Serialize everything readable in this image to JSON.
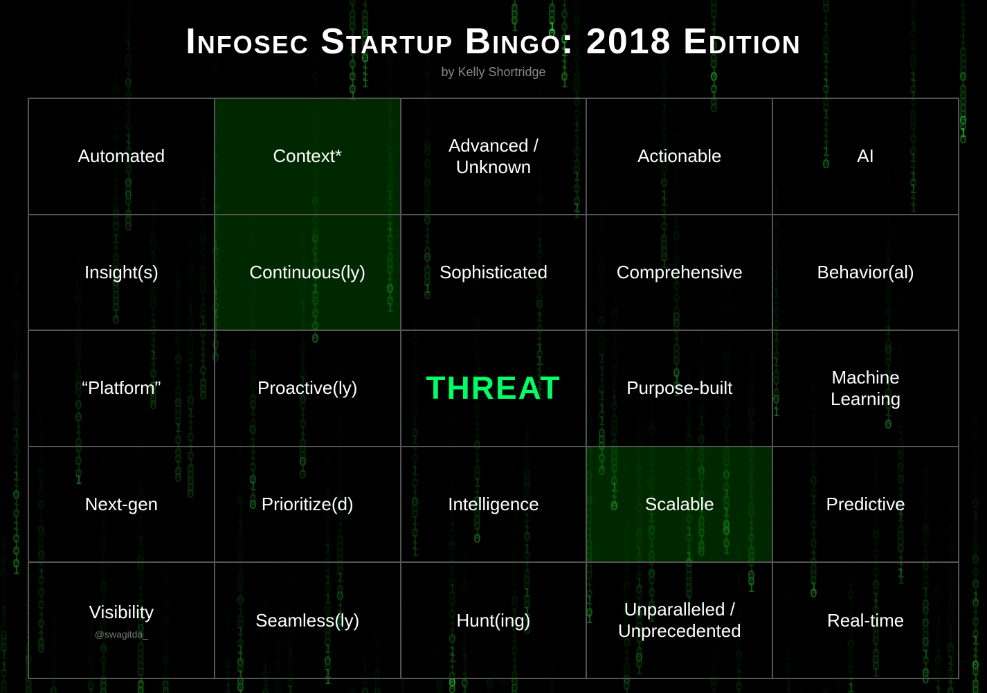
{
  "title": "Infosec Startup Bingo: 2018 Edition",
  "subtitle": "by Kelly Shortridge",
  "attribution": "@swagitda_",
  "colors": {
    "accent_green": "#00ff66",
    "text_white": "#ffffff",
    "text_gray": "#888888",
    "border": "#555555",
    "bg_cell": "rgba(0,0,0,0.45)"
  },
  "grid": [
    [
      {
        "label": "Automated",
        "highlight": false,
        "center": false
      },
      {
        "label": "Context*",
        "highlight": true,
        "center": false
      },
      {
        "label": "Advanced /\nUnknown",
        "highlight": false,
        "center": false
      },
      {
        "label": "Actionable",
        "highlight": false,
        "center": false
      },
      {
        "label": "AI",
        "highlight": false,
        "center": false
      }
    ],
    [
      {
        "label": "Insight(s)",
        "highlight": false,
        "center": false
      },
      {
        "label": "Continuous(ly)",
        "highlight": true,
        "center": false
      },
      {
        "label": "Sophisticated",
        "highlight": false,
        "center": false
      },
      {
        "label": "Comprehensive",
        "highlight": false,
        "center": false
      },
      {
        "label": "Behavior(al)",
        "highlight": false,
        "center": false
      }
    ],
    [
      {
        "label": "“Platform”",
        "highlight": false,
        "center": false
      },
      {
        "label": "Proactive(ly)",
        "highlight": false,
        "center": false
      },
      {
        "label": "THREAT",
        "highlight": false,
        "center": true
      },
      {
        "label": "Purpose-built",
        "highlight": false,
        "center": false
      },
      {
        "label": "Machine\nLearning",
        "highlight": false,
        "center": false
      }
    ],
    [
      {
        "label": "Next-gen",
        "highlight": false,
        "center": false
      },
      {
        "label": "Prioritize(d)",
        "highlight": false,
        "center": false
      },
      {
        "label": "Intelligence",
        "highlight": false,
        "center": false
      },
      {
        "label": "Scalable",
        "highlight": true,
        "center": false
      },
      {
        "label": "Predictive",
        "highlight": false,
        "center": false
      }
    ],
    [
      {
        "label": "Visibility",
        "highlight": false,
        "center": false
      },
      {
        "label": "Seamless(ly)",
        "highlight": false,
        "center": false
      },
      {
        "label": "Hunt(ing)",
        "highlight": false,
        "center": false
      },
      {
        "label": "Unparalleled /\nUnprecedented",
        "highlight": false,
        "center": false
      },
      {
        "label": "Real-time",
        "highlight": false,
        "center": false
      }
    ]
  ]
}
